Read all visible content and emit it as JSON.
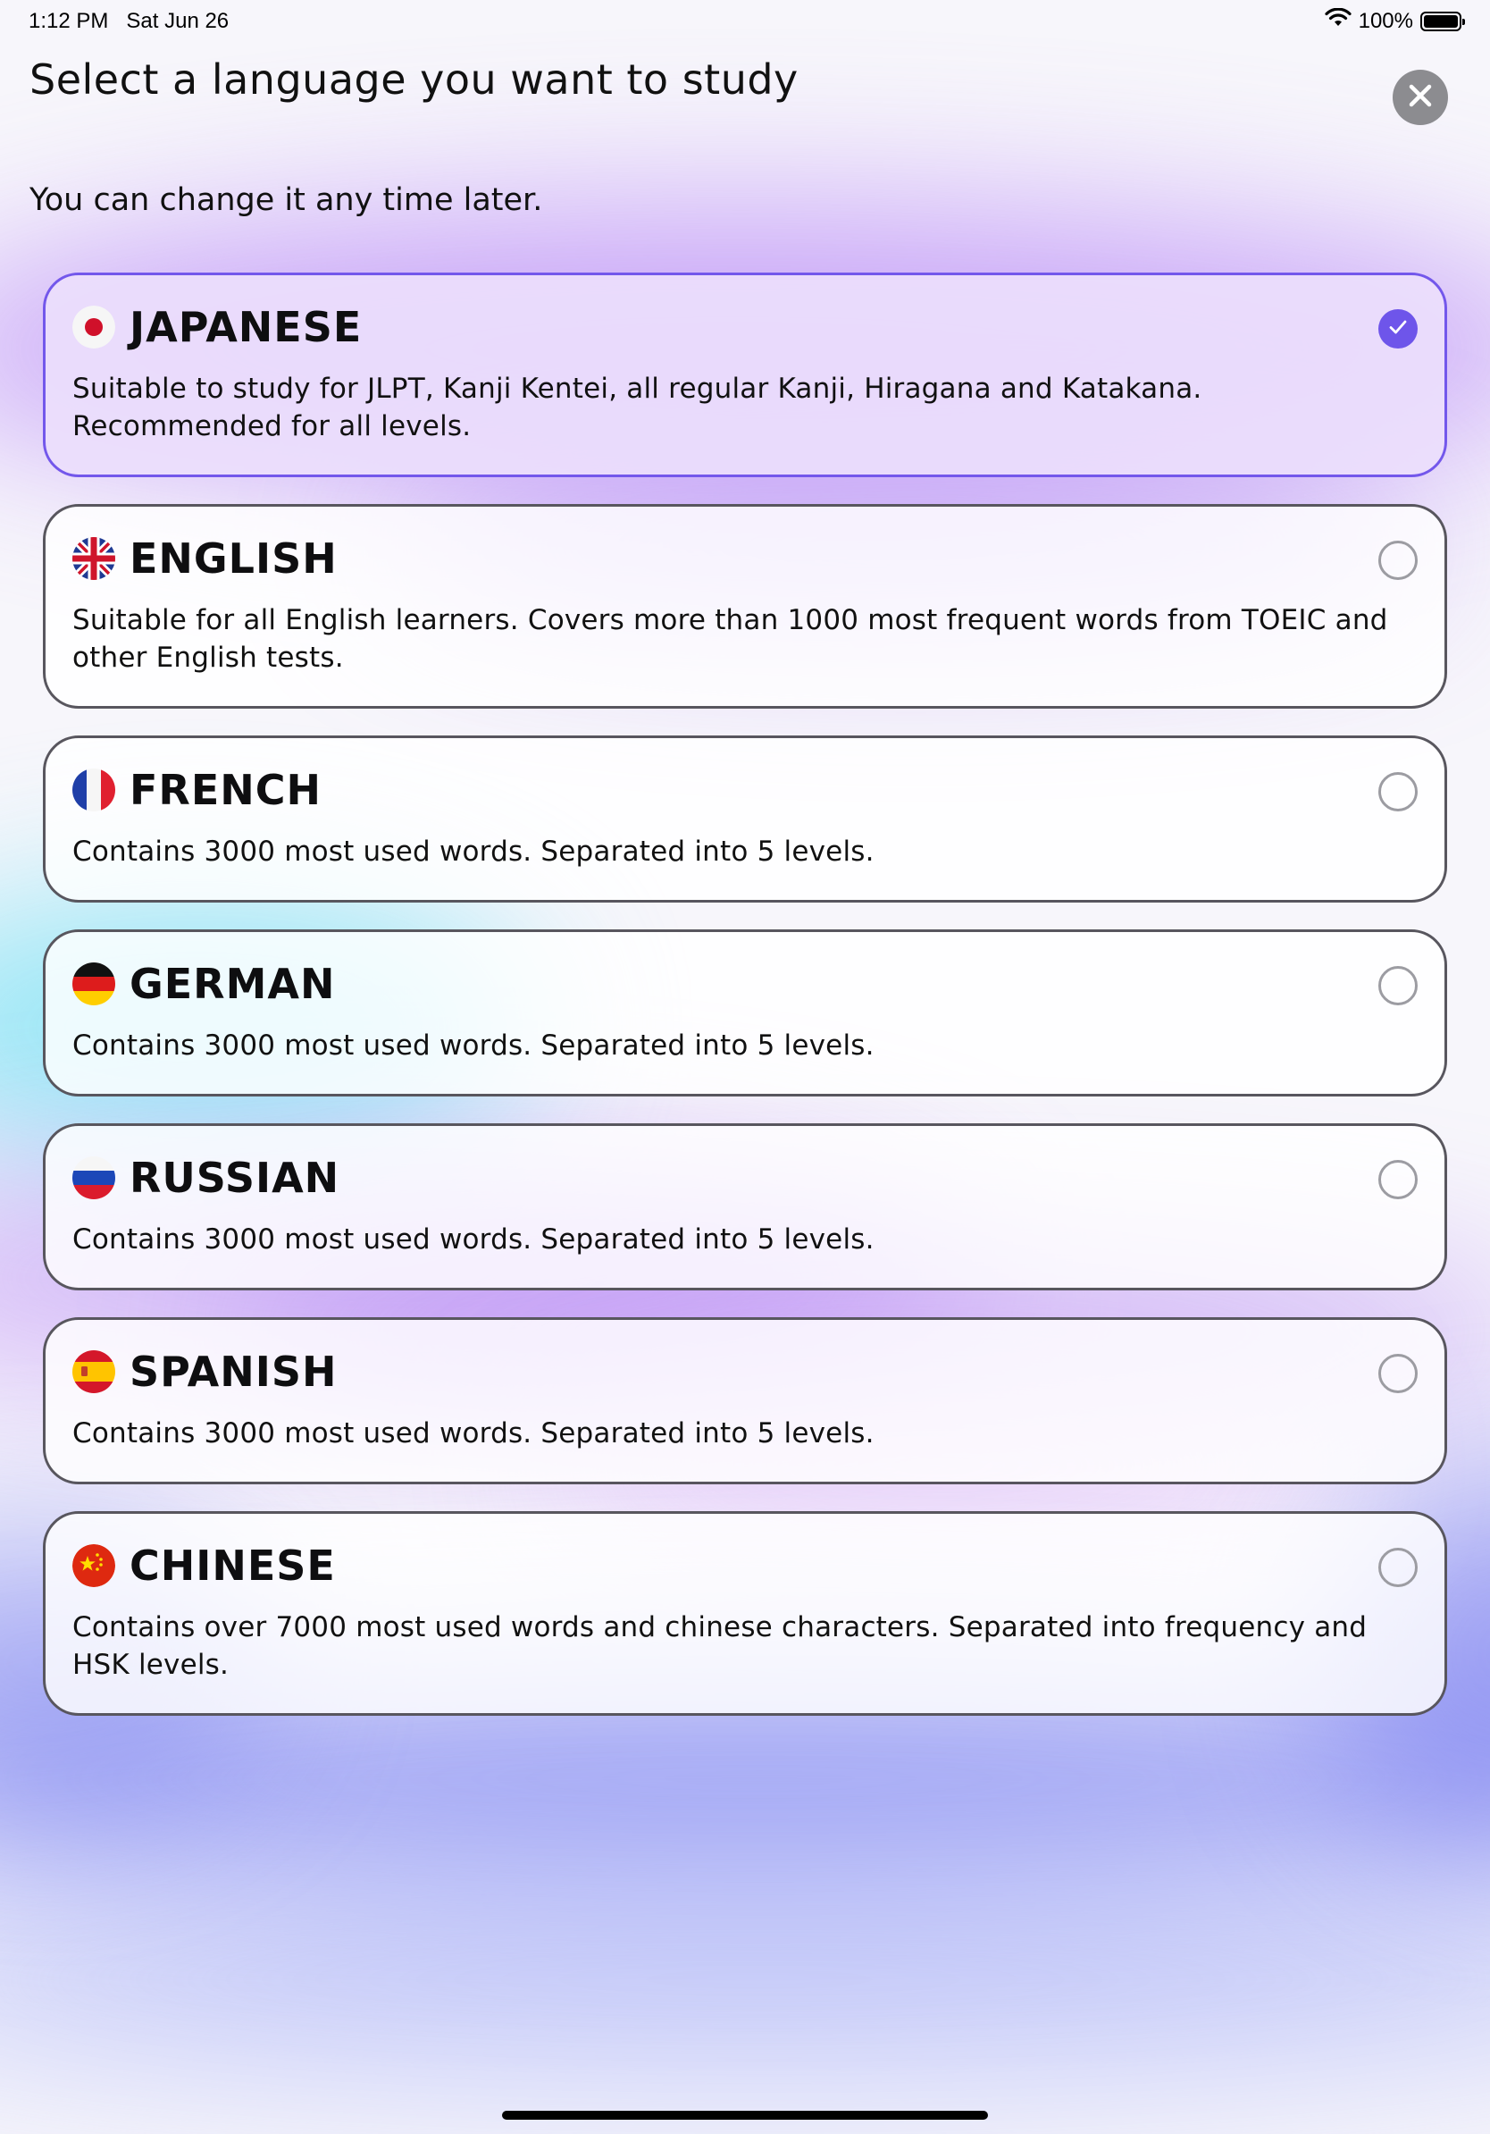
{
  "status_bar": {
    "time": "1:12 PM",
    "date": "Sat Jun 26",
    "battery_text": "100%"
  },
  "header": {
    "title": "Select a language you want to study",
    "close_icon": "close-icon"
  },
  "subtitle": "You can change it any time later.",
  "colors": {
    "accent": "#6e55ea",
    "selected_border": "#7357eb",
    "card_border": "#58565e"
  },
  "languages": [
    {
      "name": "JAPANESE",
      "flag": "japan-flag-icon",
      "selected": true,
      "description": "Suitable to study for JLPT, Kanji Kentei, all regular Kanji, Hiragana and Katakana. Recommended for all levels."
    },
    {
      "name": "ENGLISH",
      "flag": "uk-flag-icon",
      "selected": false,
      "description": "Suitable for all English learners. Covers more than 1000 most frequent words from TOEIC and other English tests."
    },
    {
      "name": "FRENCH",
      "flag": "france-flag-icon",
      "selected": false,
      "description": "Contains 3000 most used words. Separated into 5 levels."
    },
    {
      "name": "GERMAN",
      "flag": "germany-flag-icon",
      "selected": false,
      "description": "Contains 3000 most used words. Separated into 5 levels."
    },
    {
      "name": "RUSSIAN",
      "flag": "russia-flag-icon",
      "selected": false,
      "description": "Contains 3000 most used words. Separated into 5 levels."
    },
    {
      "name": "SPANISH",
      "flag": "spain-flag-icon",
      "selected": false,
      "description": "Contains 3000 most used words. Separated into 5 levels."
    },
    {
      "name": "CHINESE",
      "flag": "china-flag-icon",
      "selected": false,
      "description": "Contains over 7000 most used words and chinese characters. Separated into frequency and HSK levels."
    }
  ]
}
